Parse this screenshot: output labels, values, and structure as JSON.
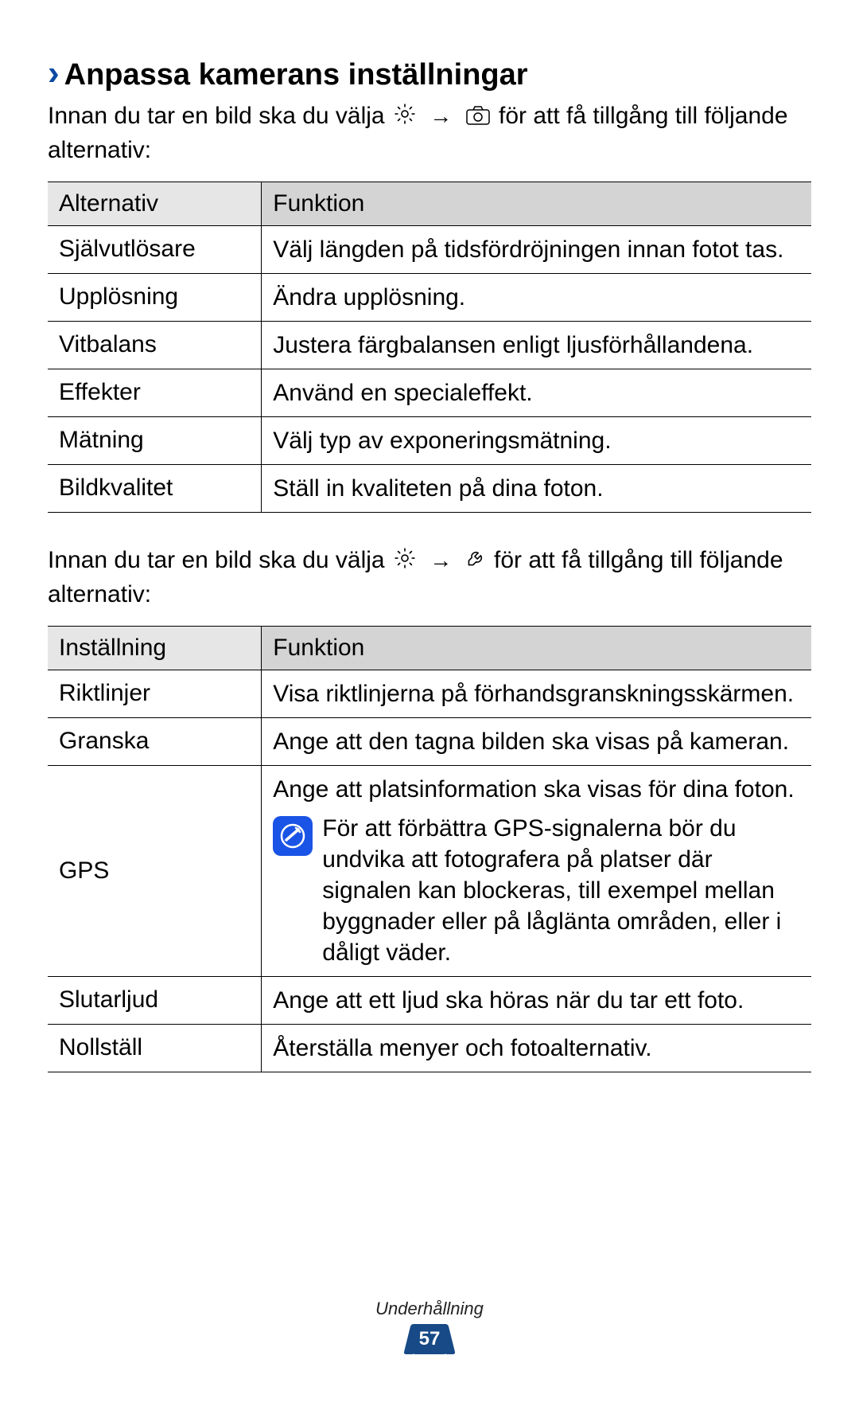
{
  "heading": "Anpassa kamerans inställningar",
  "intro1_a": "Innan du tar en bild ska du välja ",
  "intro1_b": " för att få tillgång till följande alternativ:",
  "intro2_a": "Innan du tar en bild ska du välja ",
  "intro2_b": " för att få tillgång till följande alternativ:",
  "arrow": "→",
  "table1": {
    "header": {
      "col1": "Alternativ",
      "col2": "Funktion"
    },
    "rows": [
      {
        "c1": "Självutlösare",
        "c2": "Välj längden på tidsfördröjningen innan fotot tas."
      },
      {
        "c1": "Upplösning",
        "c2": "Ändra upplösning."
      },
      {
        "c1": "Vitbalans",
        "c2": "Justera färgbalansen enligt ljusförhållandena."
      },
      {
        "c1": "Effekter",
        "c2": "Använd en specialeffekt."
      },
      {
        "c1": "Mätning",
        "c2": "Välj typ av exponeringsmätning."
      },
      {
        "c1": "Bildkvalitet",
        "c2": "Ställ in kvaliteten på dina foton."
      }
    ]
  },
  "table2": {
    "header": {
      "col1": "Inställning",
      "col2": "Funktion"
    },
    "rows": [
      {
        "c1": "Riktlinjer",
        "c2": "Visa riktlinjerna på förhandsgranskningsskärmen."
      },
      {
        "c1": "Granska",
        "c2": "Ange att den tagna bilden ska visas på kameran."
      },
      {
        "c1": "GPS",
        "c2": "Ange att platsinformation ska visas för dina foton.",
        "note": "För att förbättra GPS-signalerna bör du undvika att fotografera på platser där signalen kan blockeras, till exempel mellan byggnader eller på låglänta områden, eller i dåligt väder."
      },
      {
        "c1": "Slutarljud",
        "c2": "Ange att ett ljud ska höras när du tar ett foto."
      },
      {
        "c1": "Nollställ",
        "c2": "Återställa menyer och fotoalternativ."
      }
    ]
  },
  "footer_section": "Underhållning",
  "page_number": "57"
}
